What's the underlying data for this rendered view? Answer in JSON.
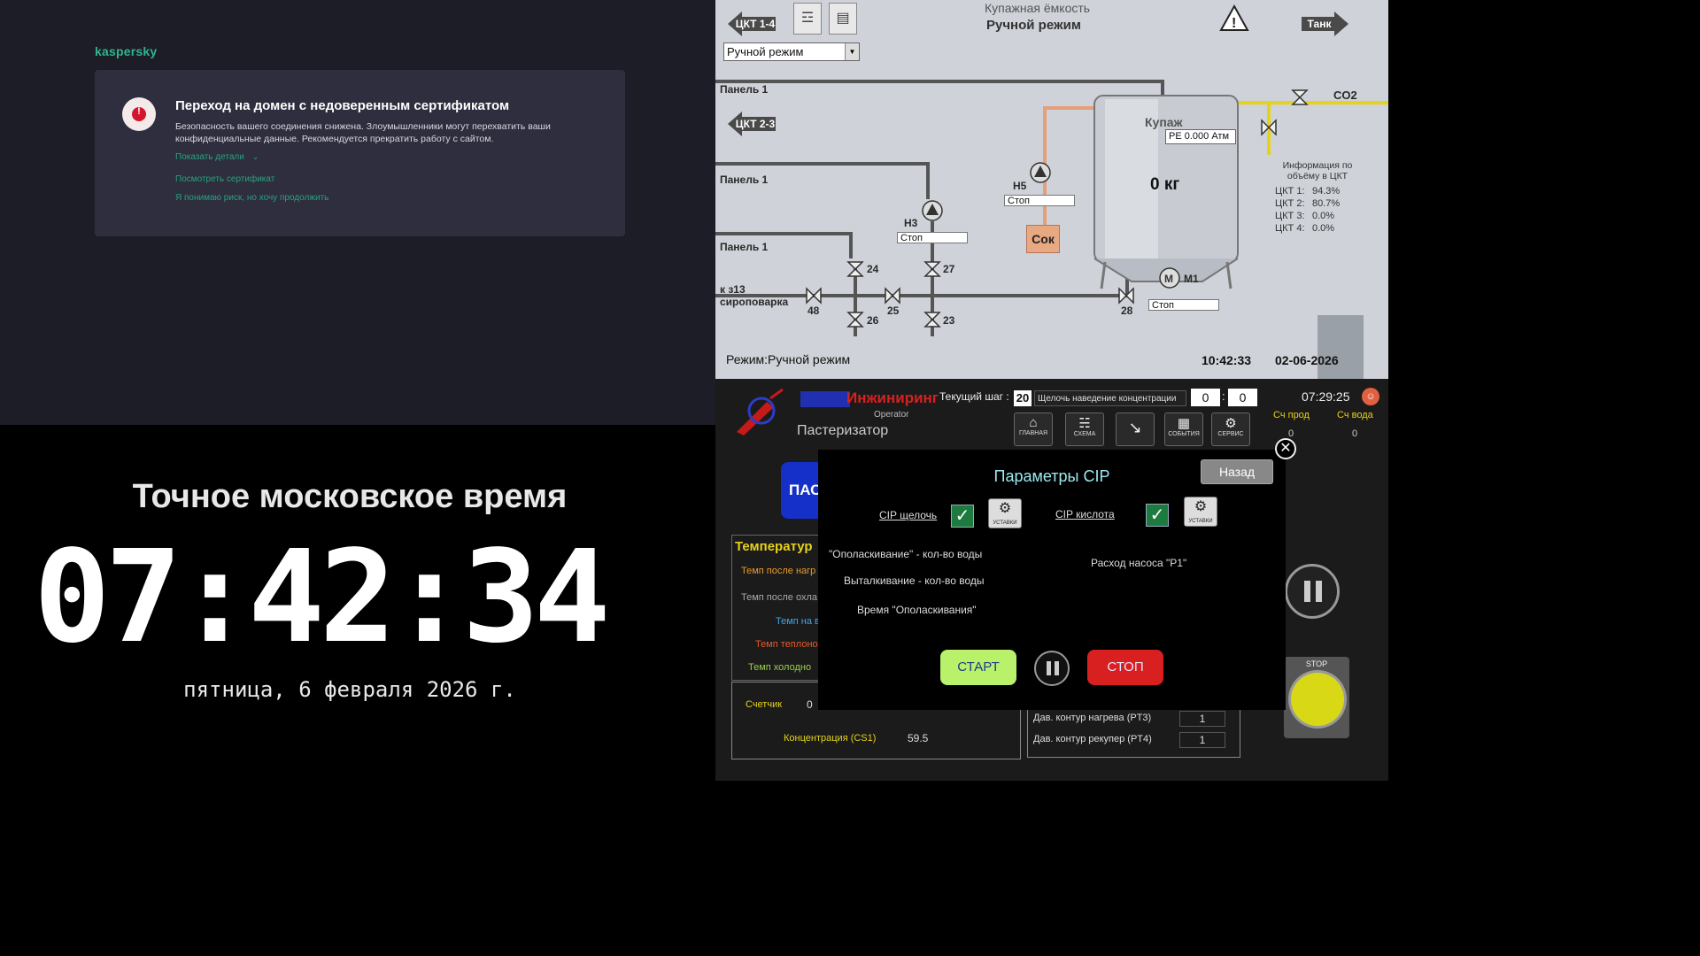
{
  "kaspersky": {
    "logo": "kaspersky",
    "alert_glyph": "!",
    "title": "Переход на домен с недоверенным сертификатом",
    "description": "Безопасность вашего соединения снижена. Злоумышленники могут перехватить ваши конфиденциальные данные. Рекомендуется прекратить работу с сайтом.",
    "show_details": "Показать детали",
    "view_certificate": "Посмотреть сертификат",
    "accept_risk": "Я понимаю риск, но хочу продолжить"
  },
  "clock": {
    "title": "Точное московское время",
    "time": "07:42:34",
    "date": "пятница, 6 февраля 2026 г."
  },
  "scada": {
    "nav_left_1": "ЦКТ 1-4",
    "nav_left_2": "ЦКТ 2-3",
    "nav_right": "Танк",
    "header_title": "Купажная ёмкость",
    "header_mode": "Ручной режим",
    "mode_select": "Ручной режим",
    "panel_1a": "Панель 1",
    "panel_1b": "Панель 1",
    "panel_1c": "Панель 1",
    "k313": "к з13",
    "syrup": "сироповарка",
    "co2": "CO2",
    "tank_name": "Купаж",
    "pressure": "PE 0.000 Атм",
    "weight": "0 кг",
    "juice": "Сок",
    "h5": "Н5",
    "h3": "Н3",
    "m1": "М1",
    "status_h5": "Стоп",
    "status_h3": "Стоп",
    "status_m1": "Стоп",
    "valves": [
      "24",
      "27",
      "48",
      "25",
      "26",
      "23",
      "28"
    ],
    "info_title": "Информация по объёму в ЦКТ",
    "ckt_levels": [
      {
        "name": "ЦКТ 1:",
        "value": "94.3%"
      },
      {
        "name": "ЦКТ 2:",
        "value": "80.7%"
      },
      {
        "name": "ЦКТ 3:",
        "value": "0.0%"
      },
      {
        "name": "ЦКТ 4:",
        "value": "0.0%"
      }
    ],
    "footer_mode": "Режим:Ручной режим",
    "footer_time": "10:42:33",
    "footer_date": "02-06-2026"
  },
  "hmi": {
    "brand": "Инжиниринг",
    "role": "Operator",
    "section": "Пастеризатор",
    "step_label": "Текущий шаг :",
    "step_num": "20",
    "step_desc": "Щелочь наведение концентрации",
    "step_min": "0",
    "step_sec": "0",
    "clock": "07:29:25",
    "toolbar": [
      "ГЛАВНАЯ",
      "СХЕМА",
      "",
      "СОБЫТИЯ",
      "СЕРВИС"
    ],
    "counter_prod_label": "Сч прод",
    "counter_prod": "0",
    "counter_water_label": "Сч вода",
    "counter_water": "0",
    "bg_button": "ПАС",
    "temp_header": "Температур",
    "temp_rows": [
      "Темп после нагр",
      "Темп после охла",
      "Темп на в",
      "Темп теплоно",
      "Темп холодно"
    ],
    "counter_label": "Счетчик",
    "counter_value": "0",
    "conc_label": "Концентрация (CS1)",
    "conc_value": "59.5",
    "pressure_rows": [
      {
        "label": "Дав. контур нагрева (PT3)",
        "value": "1"
      },
      {
        "label": "Дав. контур рекупер (PT4)",
        "value": "1"
      }
    ],
    "stop_label": "STOP",
    "modal": {
      "title": "Параметры CIP",
      "back": "Назад",
      "cip_alkali": "CIP щелочь",
      "cip_acid": "CIP кислота",
      "settings": "УСТАВКИ",
      "rinse_water": "\"Ополаскивание\" - кол-во воды",
      "push_water": "Выталкивание - кол-во воды",
      "rinse_time": "Время \"Ополаскивания\"",
      "pump_flow": "Расход насоса \"Р1\"",
      "start": "СТАРТ",
      "stop": "СТОП"
    }
  },
  "colors": {
    "kasp_green": "#2fb58c",
    "start_green": "#b9f26a",
    "stop_red": "#d82020",
    "hmi_blue": "#1530c8"
  }
}
